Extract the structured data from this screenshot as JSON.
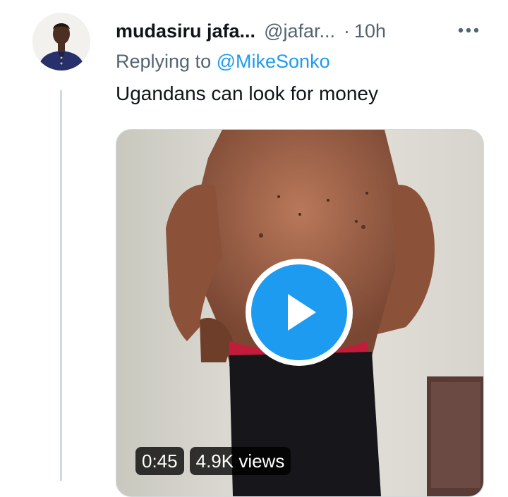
{
  "tweet": {
    "display_name": "mudasiru jafa...",
    "handle": "@jafar...",
    "separator": "·",
    "time": "10h",
    "more_icon": "more-horizontal-icon",
    "reply_prefix": "Replying to",
    "reply_to": "@MikeSonko",
    "text": "Ugandans can look for money"
  },
  "media": {
    "type": "video",
    "duration": "0:45",
    "views": "4.9K views",
    "play_icon": "play-icon"
  },
  "colors": {
    "accent": "#1d9bf0",
    "text_primary": "#0f1419",
    "text_secondary": "#536471",
    "border": "#cfd9de"
  }
}
